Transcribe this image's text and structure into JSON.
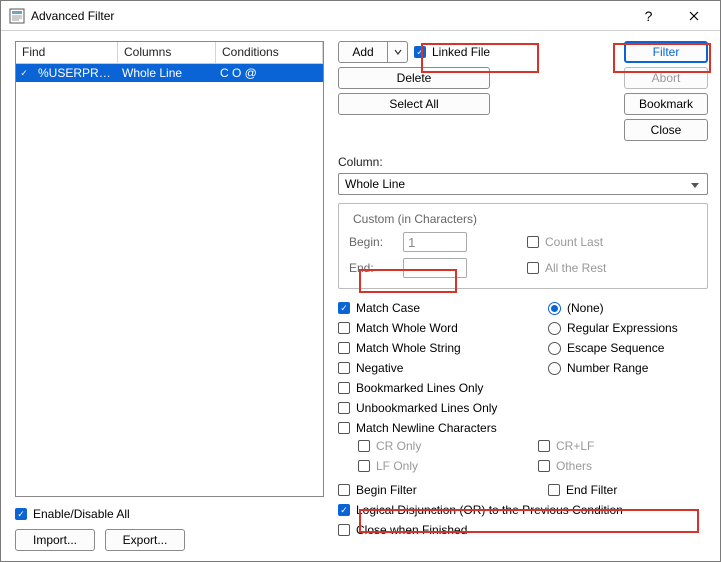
{
  "window": {
    "title": "Advanced Filter"
  },
  "list": {
    "headers": {
      "find": "Find",
      "columns": "Columns",
      "conditions": "Conditions"
    },
    "rows": [
      {
        "checked": true,
        "find": "%USERPROFI...",
        "columns": "Whole Line",
        "conditions": "C    O    @"
      }
    ]
  },
  "left": {
    "enable_all": "Enable/Disable All",
    "import": "Import...",
    "export": "Export..."
  },
  "top": {
    "add": "Add",
    "delete": "Delete",
    "select_all": "Select All",
    "linked_file": "Linked File",
    "filter": "Filter",
    "abort": "Abort",
    "bookmark": "Bookmark",
    "close": "Close"
  },
  "column": {
    "label": "Column:",
    "value": "Whole Line"
  },
  "custom": {
    "legend": "Custom (in Characters)",
    "begin_label": "Begin:",
    "begin_value": "1",
    "end_label": "End:",
    "count_last": "Count Last",
    "all_rest": "All the Rest"
  },
  "opts": {
    "match_case": "Match Case",
    "none": "(None)",
    "match_word": "Match Whole Word",
    "regex": "Regular Expressions",
    "match_string": "Match Whole String",
    "escape": "Escape Sequence",
    "negative": "Negative",
    "numrange": "Number Range",
    "bookmarked": "Bookmarked Lines Only",
    "unbookmarked": "Unbookmarked Lines Only",
    "newline": "Match Newline Characters",
    "cr_only": "CR Only",
    "crlf": "CR+LF",
    "lf_only": "LF Only",
    "others": "Others",
    "begin_filter": "Begin Filter",
    "end_filter": "End Filter",
    "logical_or": "Logical Disjunction (OR) to the Previous Condition",
    "close_finished": "Close when Finished"
  }
}
